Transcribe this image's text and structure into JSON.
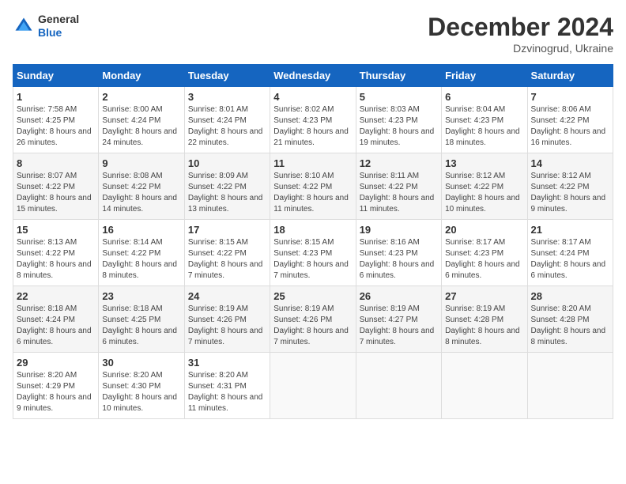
{
  "header": {
    "logo": {
      "general": "General",
      "blue": "Blue"
    },
    "title": "December 2024",
    "location": "Dzvinogrud, Ukraine"
  },
  "calendar": {
    "weekdays": [
      "Sunday",
      "Monday",
      "Tuesday",
      "Wednesday",
      "Thursday",
      "Friday",
      "Saturday"
    ],
    "weeks": [
      [
        {
          "day": "1",
          "sunrise": "7:58 AM",
          "sunset": "4:25 PM",
          "daylight": "8 hours and 26 minutes."
        },
        {
          "day": "2",
          "sunrise": "8:00 AM",
          "sunset": "4:24 PM",
          "daylight": "8 hours and 24 minutes."
        },
        {
          "day": "3",
          "sunrise": "8:01 AM",
          "sunset": "4:24 PM",
          "daylight": "8 hours and 22 minutes."
        },
        {
          "day": "4",
          "sunrise": "8:02 AM",
          "sunset": "4:23 PM",
          "daylight": "8 hours and 21 minutes."
        },
        {
          "day": "5",
          "sunrise": "8:03 AM",
          "sunset": "4:23 PM",
          "daylight": "8 hours and 19 minutes."
        },
        {
          "day": "6",
          "sunrise": "8:04 AM",
          "sunset": "4:23 PM",
          "daylight": "8 hours and 18 minutes."
        },
        {
          "day": "7",
          "sunrise": "8:06 AM",
          "sunset": "4:22 PM",
          "daylight": "8 hours and 16 minutes."
        }
      ],
      [
        {
          "day": "8",
          "sunrise": "8:07 AM",
          "sunset": "4:22 PM",
          "daylight": "8 hours and 15 minutes."
        },
        {
          "day": "9",
          "sunrise": "8:08 AM",
          "sunset": "4:22 PM",
          "daylight": "8 hours and 14 minutes."
        },
        {
          "day": "10",
          "sunrise": "8:09 AM",
          "sunset": "4:22 PM",
          "daylight": "8 hours and 13 minutes."
        },
        {
          "day": "11",
          "sunrise": "8:10 AM",
          "sunset": "4:22 PM",
          "daylight": "8 hours and 11 minutes."
        },
        {
          "day": "12",
          "sunrise": "8:11 AM",
          "sunset": "4:22 PM",
          "daylight": "8 hours and 11 minutes."
        },
        {
          "day": "13",
          "sunrise": "8:12 AM",
          "sunset": "4:22 PM",
          "daylight": "8 hours and 10 minutes."
        },
        {
          "day": "14",
          "sunrise": "8:12 AM",
          "sunset": "4:22 PM",
          "daylight": "8 hours and 9 minutes."
        }
      ],
      [
        {
          "day": "15",
          "sunrise": "8:13 AM",
          "sunset": "4:22 PM",
          "daylight": "8 hours and 8 minutes."
        },
        {
          "day": "16",
          "sunrise": "8:14 AM",
          "sunset": "4:22 PM",
          "daylight": "8 hours and 8 minutes."
        },
        {
          "day": "17",
          "sunrise": "8:15 AM",
          "sunset": "4:22 PM",
          "daylight": "8 hours and 7 minutes."
        },
        {
          "day": "18",
          "sunrise": "8:15 AM",
          "sunset": "4:23 PM",
          "daylight": "8 hours and 7 minutes."
        },
        {
          "day": "19",
          "sunrise": "8:16 AM",
          "sunset": "4:23 PM",
          "daylight": "8 hours and 6 minutes."
        },
        {
          "day": "20",
          "sunrise": "8:17 AM",
          "sunset": "4:23 PM",
          "daylight": "8 hours and 6 minutes."
        },
        {
          "day": "21",
          "sunrise": "8:17 AM",
          "sunset": "4:24 PM",
          "daylight": "8 hours and 6 minutes."
        }
      ],
      [
        {
          "day": "22",
          "sunrise": "8:18 AM",
          "sunset": "4:24 PM",
          "daylight": "8 hours and 6 minutes."
        },
        {
          "day": "23",
          "sunrise": "8:18 AM",
          "sunset": "4:25 PM",
          "daylight": "8 hours and 6 minutes."
        },
        {
          "day": "24",
          "sunrise": "8:19 AM",
          "sunset": "4:26 PM",
          "daylight": "8 hours and 7 minutes."
        },
        {
          "day": "25",
          "sunrise": "8:19 AM",
          "sunset": "4:26 PM",
          "daylight": "8 hours and 7 minutes."
        },
        {
          "day": "26",
          "sunrise": "8:19 AM",
          "sunset": "4:27 PM",
          "daylight": "8 hours and 7 minutes."
        },
        {
          "day": "27",
          "sunrise": "8:19 AM",
          "sunset": "4:28 PM",
          "daylight": "8 hours and 8 minutes."
        },
        {
          "day": "28",
          "sunrise": "8:20 AM",
          "sunset": "4:28 PM",
          "daylight": "8 hours and 8 minutes."
        }
      ],
      [
        {
          "day": "29",
          "sunrise": "8:20 AM",
          "sunset": "4:29 PM",
          "daylight": "8 hours and 9 minutes."
        },
        {
          "day": "30",
          "sunrise": "8:20 AM",
          "sunset": "4:30 PM",
          "daylight": "8 hours and 10 minutes."
        },
        {
          "day": "31",
          "sunrise": "8:20 AM",
          "sunset": "4:31 PM",
          "daylight": "8 hours and 11 minutes."
        },
        null,
        null,
        null,
        null
      ]
    ]
  }
}
